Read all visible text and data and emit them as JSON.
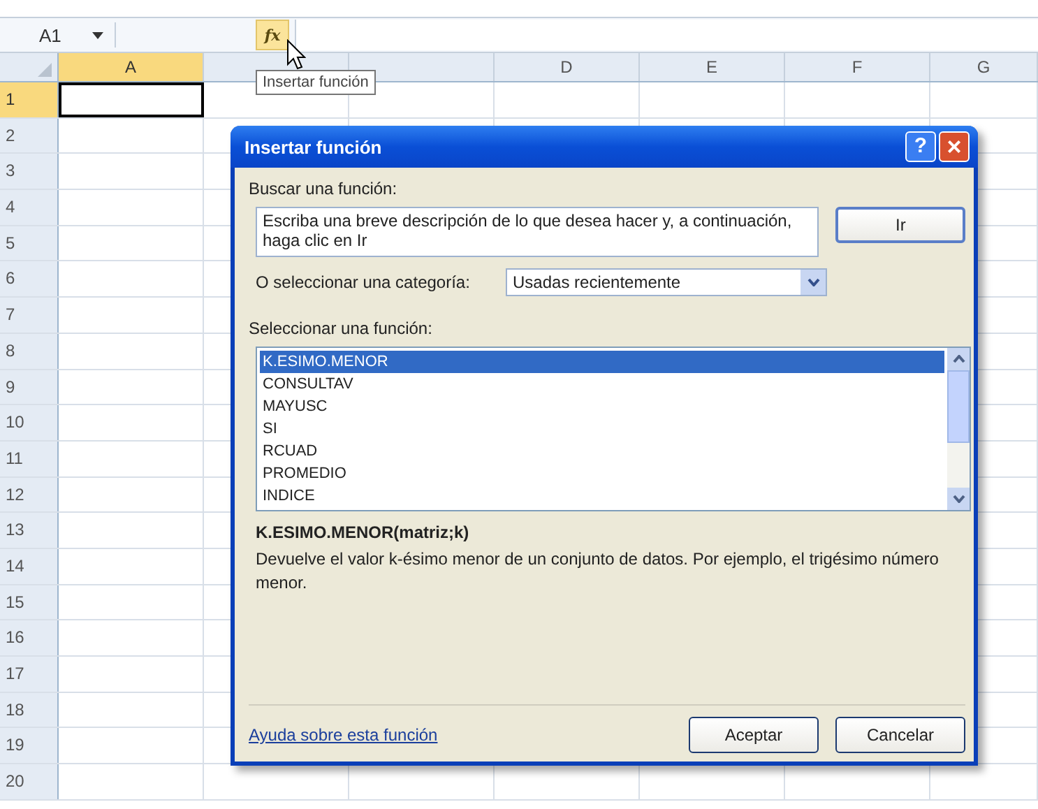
{
  "formula_bar": {
    "name_box": "A1",
    "fx": "fx"
  },
  "tooltip": {
    "text": "Insertar función"
  },
  "columns": [
    {
      "label": "A",
      "selected": true
    },
    {
      "selected": false
    },
    {
      "selected": false
    },
    {
      "label": "D",
      "selected": false
    },
    {
      "label": "E",
      "selected": false
    },
    {
      "label": "F",
      "selected": false
    },
    {
      "label": "G",
      "selected": false
    }
  ],
  "rows": [
    {
      "label": "1",
      "selected": true
    },
    {
      "label": "2",
      "selected": false
    },
    {
      "label": "3",
      "selected": false
    },
    {
      "label": "4",
      "selected": false
    },
    {
      "label": "5",
      "selected": false
    },
    {
      "label": "6",
      "selected": false
    },
    {
      "label": "7",
      "selected": false
    },
    {
      "label": "8",
      "selected": false
    },
    {
      "label": "9",
      "selected": false
    },
    {
      "label": "10",
      "selected": false
    },
    {
      "label": "11",
      "selected": false
    },
    {
      "label": "12",
      "selected": false
    },
    {
      "label": "13",
      "selected": false
    },
    {
      "label": "14",
      "selected": false
    },
    {
      "label": "15",
      "selected": false
    },
    {
      "label": "16",
      "selected": false
    },
    {
      "label": "17",
      "selected": false
    },
    {
      "label": "18",
      "selected": false
    },
    {
      "label": "19",
      "selected": false
    },
    {
      "label": "20",
      "selected": false
    }
  ],
  "dialog": {
    "title": "Insertar función",
    "help": "?",
    "close": "×",
    "search_label": "Buscar una función:",
    "search_value": "Escriba una breve descripción de lo que desea hacer y, a continuación, haga clic en Ir",
    "go_button": "Ir",
    "category_label": "O seleccionar una categoría:",
    "category_value": "Usadas recientemente",
    "function_label": "Seleccionar una función:",
    "functions": [
      {
        "name": "K.ESIMO.MENOR",
        "selected": true
      },
      {
        "name": "CONSULTAV",
        "selected": false
      },
      {
        "name": "MAYUSC",
        "selected": false
      },
      {
        "name": "SI",
        "selected": false
      },
      {
        "name": "RCUAD",
        "selected": false
      },
      {
        "name": "PROMEDIO",
        "selected": false
      },
      {
        "name": "INDICE",
        "selected": false
      }
    ],
    "signature": "K.ESIMO.MENOR(matriz;k)",
    "description": "Devuelve el valor k-ésimo menor de un conjunto de datos. Por ejemplo, el trigésimo número menor.",
    "help_link": "Ayuda sobre esta función",
    "buttons": [
      "Aceptar",
      "Cancelar"
    ]
  }
}
